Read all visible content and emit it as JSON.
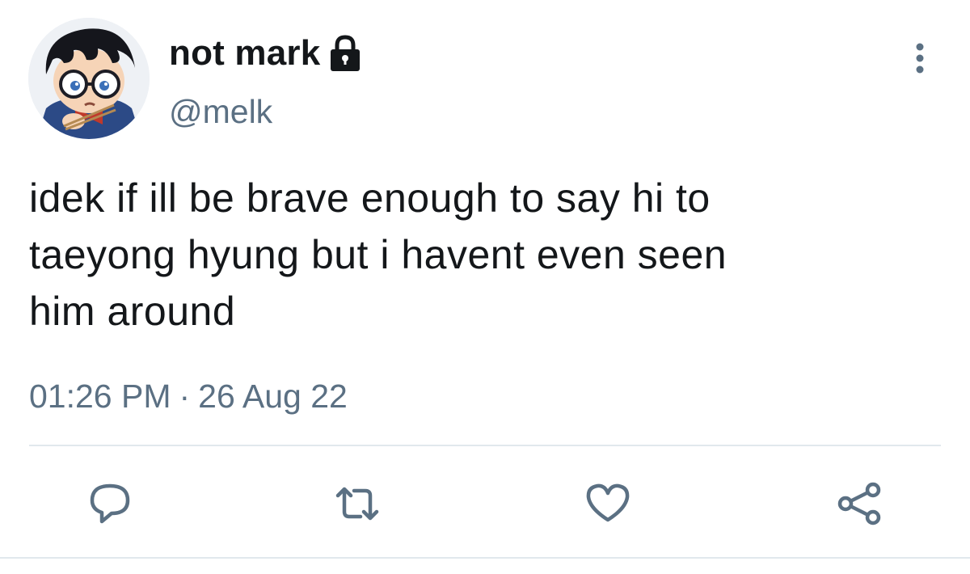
{
  "tweet": {
    "display_name": "not mark",
    "handle": "@melk",
    "protected": true,
    "text": "idek if ill be brave enough to say hi to\ntaeyong hyung but i havent even seen\nhim around",
    "time": "01:26 PM",
    "separator": "·",
    "date": "26 Aug 22"
  },
  "icons": {
    "lock": "lock-icon",
    "more": "more-vertical-icon",
    "reply": "reply-icon",
    "retweet": "retweet-icon",
    "like": "heart-icon",
    "share": "share-icon"
  },
  "colors": {
    "text": "#14171a",
    "secondary": "#5b7083",
    "icon": "#5b7083",
    "divider": "#e1e8ed"
  }
}
